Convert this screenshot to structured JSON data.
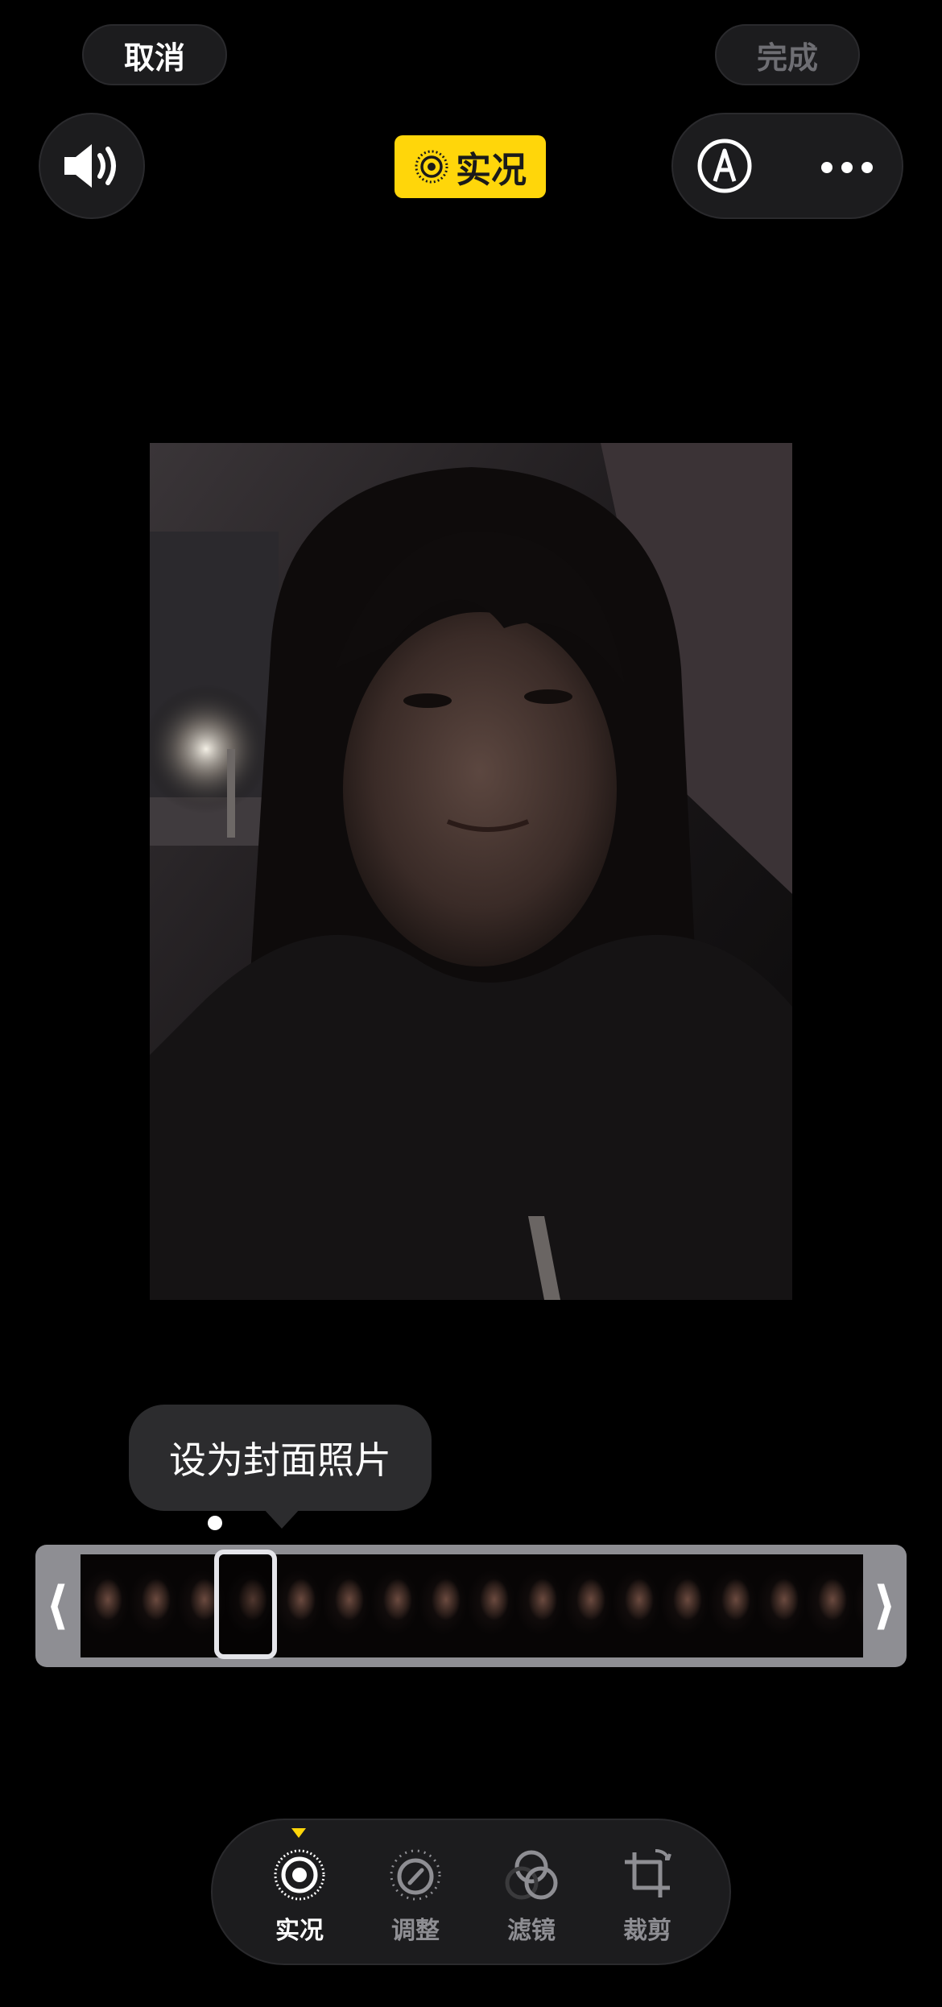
{
  "top_bar": {
    "cancel_label": "取消",
    "done_label": "完成",
    "live_label": "实况"
  },
  "icons": {
    "sound": "speaker-on-icon",
    "live": "live-photo-icon",
    "markup": "markup-pen-icon",
    "more": "ellipsis-icon"
  },
  "tooltip": {
    "text": "设为封面照片"
  },
  "scrubber": {
    "left_label": "⟨",
    "right_label": "⟩"
  },
  "toolbar": {
    "items": [
      {
        "label": "实况",
        "icon": "live-photo-icon",
        "active": true
      },
      {
        "label": "调整",
        "icon": "adjust-dial-icon",
        "active": false
      },
      {
        "label": "滤镜",
        "icon": "filters-icon",
        "active": false
      },
      {
        "label": "裁剪",
        "icon": "crop-icon",
        "active": false
      }
    ]
  },
  "colors": {
    "accent": "#ffd60a",
    "button_bg": "#1c1c1e",
    "disabled_text": "#6e6e73",
    "scrubber_bg": "#8e8e93"
  }
}
